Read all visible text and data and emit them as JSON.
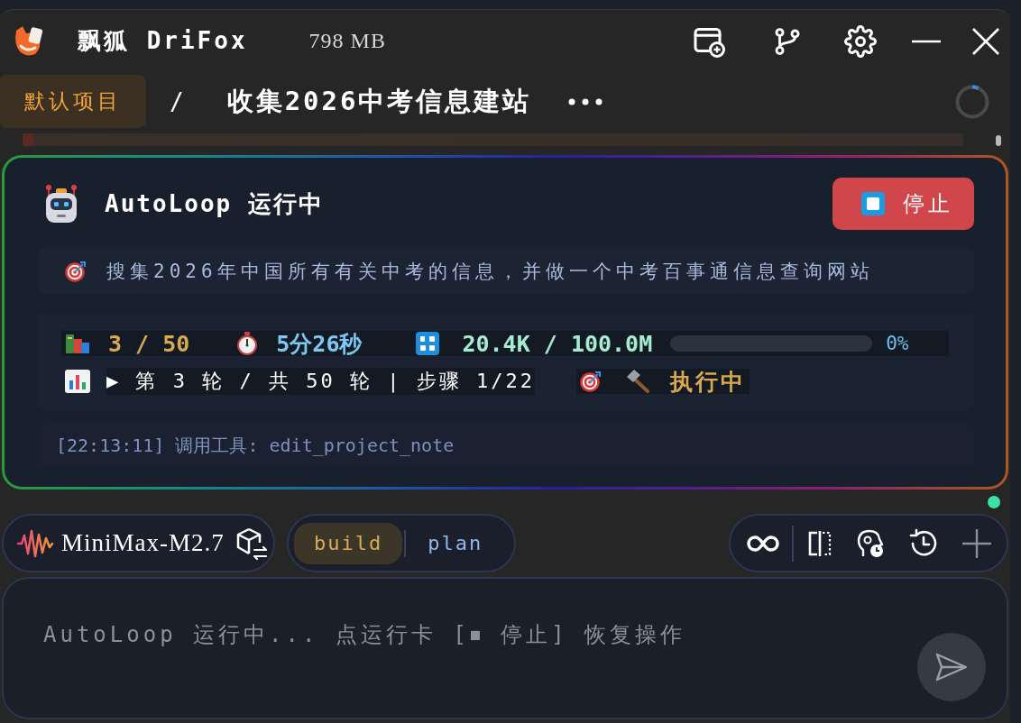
{
  "window": {
    "app_name": "飘狐 DriFox",
    "memory": "798 MB"
  },
  "breadcrumb": {
    "project": "默认项目",
    "separator": "/",
    "title": "收集2026中考信息建站"
  },
  "autoloop_card": {
    "title": "AutoLoop 运行中",
    "stop_button": "停止",
    "goal": "搜集2026年中国所有有关中考的信息，并做一个中考百事通信息查询网站",
    "stats": {
      "rounds": "3 / 50",
      "elapsed": "5分26秒",
      "tokens": "20.4K / 100.0M",
      "token_usage": {
        "level": 0,
        "reading": "0%"
      },
      "progress": "▶ 第 3 轮 / 共 50 轮 | 步骤 1/22",
      "status": "执行中"
    },
    "log": "[22:13:11] 调用工具: edit_project_note"
  },
  "toolbar": {
    "model": "MiniMax-M2.7",
    "modes": [
      {
        "label": "build",
        "selected": true
      },
      {
        "label": "plan",
        "selected": false
      }
    ]
  },
  "composer": {
    "placeholder": "AutoLoop 运行中... 点运行卡 [⏹ 停止] 恢复操作"
  }
}
